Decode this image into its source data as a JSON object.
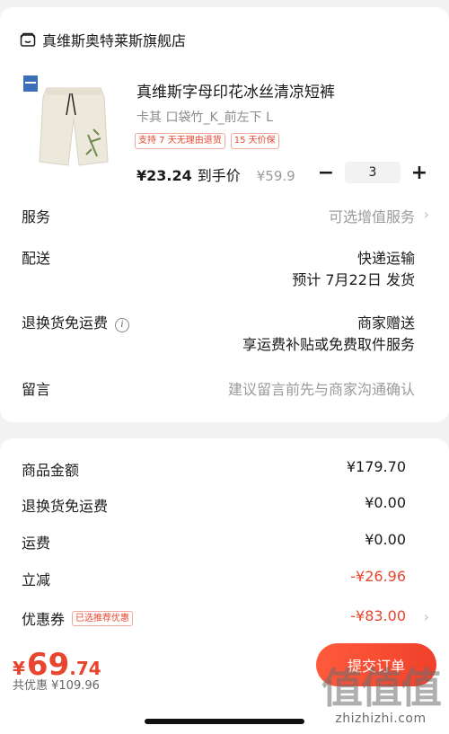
{
  "store": {
    "name": "真维斯奥特莱斯旗舰店",
    "icon": "store-icon"
  },
  "product": {
    "title": "真维斯字母印花冰丝清凉短裤",
    "spec": "卡其 口袋竹_K_前左下  L",
    "tags": [
      "支持 7 天无理由退货",
      "15 天价保"
    ],
    "price": "¥23.24",
    "price_suffix": "到手价",
    "original_price": "¥59.9",
    "quantity": "3",
    "minus": "−",
    "plus": "+"
  },
  "services": {
    "service_label": "服务",
    "service_value": "可选增值服务",
    "delivery_label": "配送",
    "delivery_method": "快递运输",
    "delivery_eta": "预计 7月22日 发货",
    "return_label": "退换货免运费",
    "return_value_1": "商家赠送",
    "return_value_2": "享运费补贴或免费取件服务",
    "note_label": "留言",
    "note_placeholder": "建议留言前先与商家沟通确认",
    "chevron": "›"
  },
  "summary": {
    "goods_label": "商品金额",
    "goods_value": "¥179.70",
    "return_fee_label": "退换货免运费",
    "return_fee_value": "¥0.00",
    "shipping_label": "运费",
    "shipping_value": "¥0.00",
    "discount_label": "立减",
    "discount_value": "-¥26.96",
    "coupon_label": "优惠券",
    "coupon_tag": "已选推荐优惠",
    "coupon_value": "-¥83.00"
  },
  "bottom": {
    "currency": "¥",
    "total_int": "69",
    "total_dec": ".74",
    "saving": "共优惠 ¥109.96",
    "submit_label": "提交订单"
  },
  "watermark": {
    "glyphs": "值值值",
    "url": "zhizhizhi.com"
  },
  "colors": {
    "accent": "#e8452f",
    "background": "#f2f2f2",
    "card": "#ffffff"
  }
}
